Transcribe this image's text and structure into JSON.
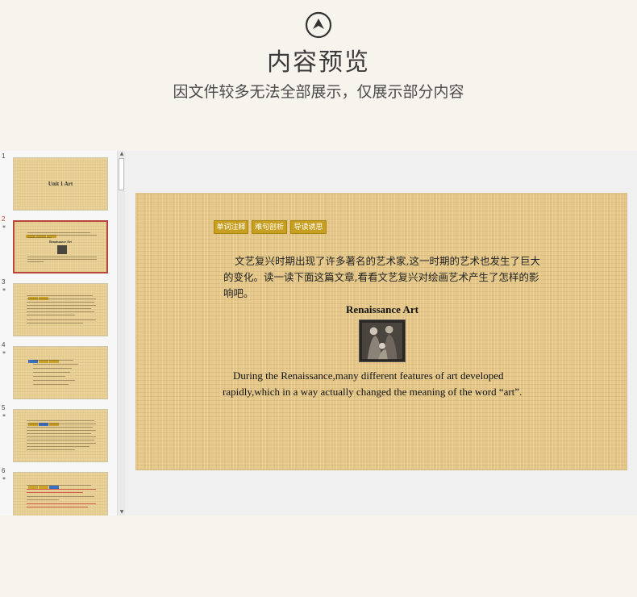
{
  "header": {
    "title": "内容预览",
    "subtitle": "因文件较多无法全部展示，仅展示部分内容"
  },
  "thumbnails": [
    {
      "number": "1",
      "starred": false,
      "active": false,
      "title": "Unit 1    Art"
    },
    {
      "number": "2",
      "starred": true,
      "active": true,
      "title": "Renaissance Art"
    },
    {
      "number": "3",
      "starred": true,
      "active": false,
      "title": ""
    },
    {
      "number": "4",
      "starred": true,
      "active": false,
      "title": ""
    },
    {
      "number": "5",
      "starred": true,
      "active": false,
      "title": ""
    },
    {
      "number": "6",
      "starred": true,
      "active": false,
      "title": ""
    }
  ],
  "slide": {
    "tabs": [
      "单词注释",
      "难句剖析",
      "导读诱思"
    ],
    "chinese_paragraph": "文艺复兴时期出现了许多著名的艺术家,这一时期的艺术也发生了巨大的变化。读一读下面这篇文章,看看文艺复兴对绘画艺术产生了怎样的影响吧。",
    "heading": "Renaissance Art",
    "english_paragraph": "During the Renaissance,many different features of art developed rapidly,which in a way actually changed the meaning of the word “art”."
  },
  "star_symbol": "*",
  "colors": {
    "accent_gold": "#c79e20",
    "active_border": "#b8463a",
    "parchment": "#e6c98a"
  }
}
